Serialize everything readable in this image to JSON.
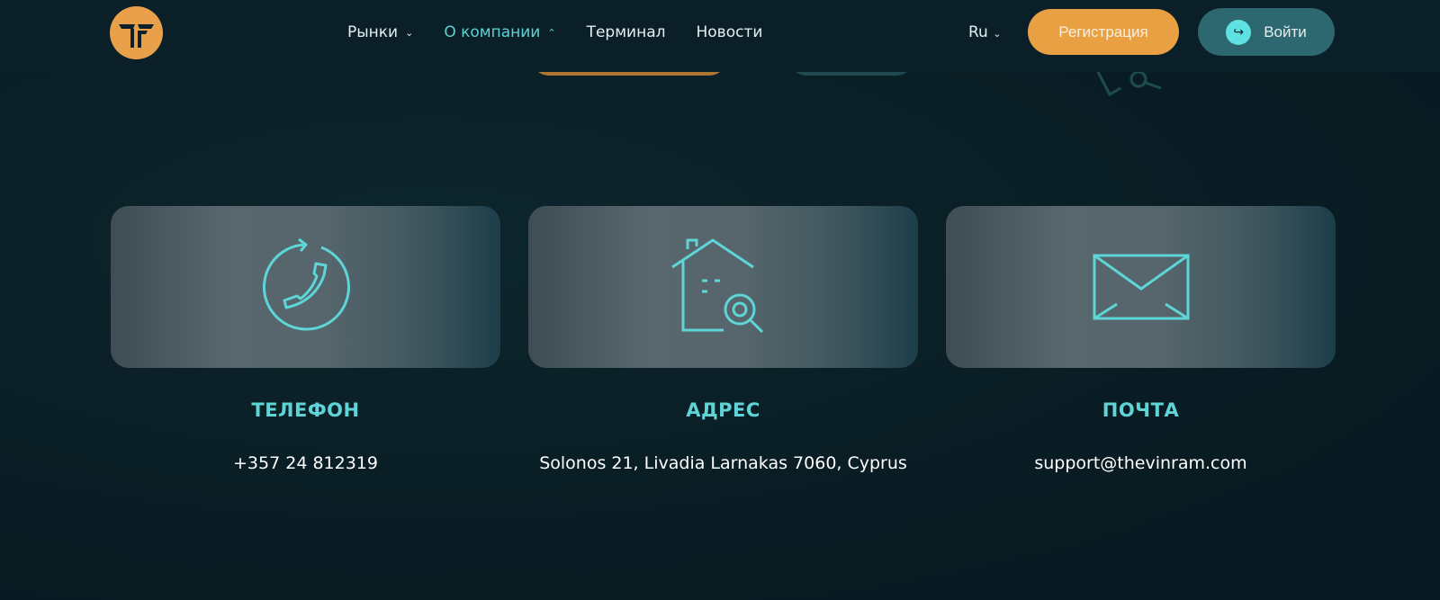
{
  "header": {
    "nav": [
      {
        "label": "Рынки",
        "state": "collapsed"
      },
      {
        "label": "О компании",
        "state": "expanded"
      },
      {
        "label": "Терминал"
      },
      {
        "label": "Новости"
      }
    ],
    "language": "Ru",
    "register_label": "Регистрация",
    "login_label": "Войти"
  },
  "colors": {
    "accent": "#5fd4d6",
    "brand": "#e9a043",
    "login": "#2d6870"
  },
  "contacts": [
    {
      "title": "ТЕЛЕФОН",
      "value": "+357 24 812319",
      "icon": "phone-icon"
    },
    {
      "title": "АДРЕС",
      "value": "Solonos 21, Livadia Larnakas 7060, Cyprus",
      "icon": "house-search-icon"
    },
    {
      "title": "ПОЧТА",
      "value": "support@thevinram.com",
      "icon": "envelope-icon"
    }
  ]
}
